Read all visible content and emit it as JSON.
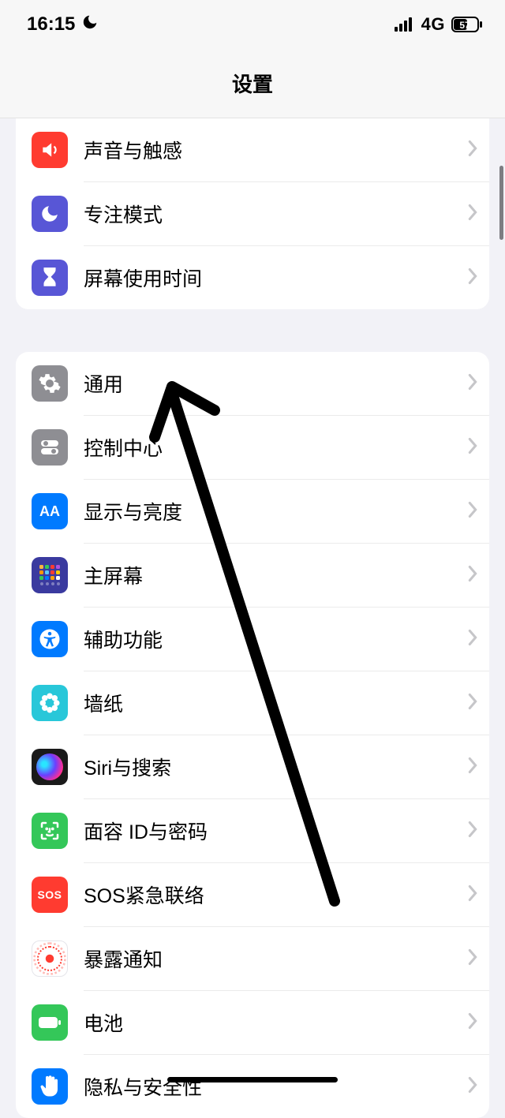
{
  "statusbar": {
    "time": "16:15",
    "focus_icon": "moon-icon",
    "network_type": "4G",
    "battery_percent": "57"
  },
  "header": {
    "title": "设置"
  },
  "group1": {
    "items": [
      {
        "id": "sound",
        "label": "声音与触感"
      },
      {
        "id": "focus",
        "label": "专注模式"
      },
      {
        "id": "screentime",
        "label": "屏幕使用时间"
      }
    ]
  },
  "group2": {
    "items": [
      {
        "id": "general",
        "label": "通用"
      },
      {
        "id": "control",
        "label": "控制中心"
      },
      {
        "id": "display",
        "label": "显示与亮度"
      },
      {
        "id": "home",
        "label": "主屏幕"
      },
      {
        "id": "access",
        "label": "辅助功能"
      },
      {
        "id": "wallpaper",
        "label": "墙纸"
      },
      {
        "id": "siri",
        "label": "Siri与搜索"
      },
      {
        "id": "faceid",
        "label": "面容 ID与密码"
      },
      {
        "id": "sos",
        "label": "SOS紧急联络",
        "badge_text": "SOS"
      },
      {
        "id": "exposure",
        "label": "暴露通知"
      },
      {
        "id": "battery",
        "label": "电池"
      },
      {
        "id": "privacy",
        "label": "隐私与安全性"
      }
    ]
  },
  "annotation": {
    "type": "arrow",
    "target": "general"
  }
}
